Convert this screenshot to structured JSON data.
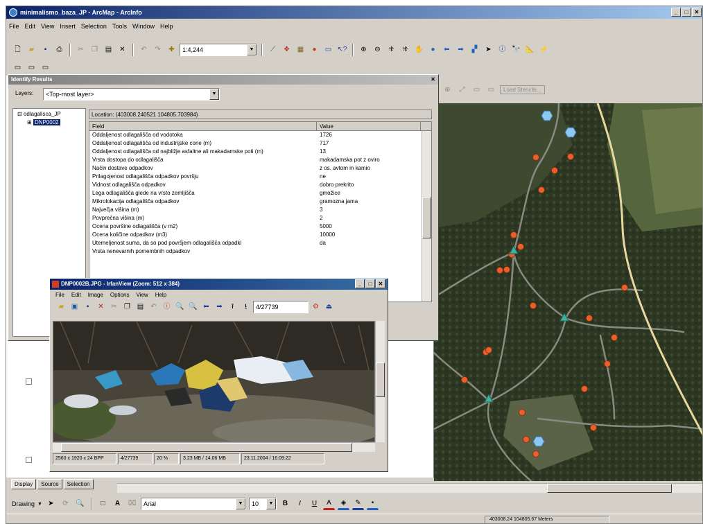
{
  "app": {
    "title": "minimalismo_baza_JP - ArcMap - ArcInfo"
  },
  "menu": [
    "File",
    "Edit",
    "View",
    "Insert",
    "Selection",
    "Tools",
    "Window",
    "Help"
  ],
  "toolbar": {
    "scale": "1:4,244"
  },
  "layer_toolbar": {
    "label": "Load Stencils..."
  },
  "identify": {
    "title": "Identify Results",
    "layers_label": "Layers:",
    "layers_value": "<Top-most layer>",
    "tree_root": "odlagalisca_JP",
    "tree_child": "DNP0002",
    "location": "Location: (403008.240521 104805.703984)",
    "col_field": "Field",
    "col_value": "Value",
    "rows": [
      {
        "f": "Oddaljenost odlagališča od vodotoka",
        "v": "1726"
      },
      {
        "f": "Oddaljenost odlagališča od industrijske cone (m)",
        "v": "717"
      },
      {
        "f": "Oddaljenost odlagališča od najbližje asfaltne ali makadamske poti (m)",
        "v": "13"
      },
      {
        "f": "Vrsta dostopa do odlagališča",
        "v": "makadamska pot z oviro"
      },
      {
        "f": "Način dostave odpadkov",
        "v": "z os. avtom in kamio"
      },
      {
        "f": "Prilagojenost odlagališča odpadkov površju",
        "v": "ne"
      },
      {
        "f": "Vidnost odlagališča odpadkov",
        "v": "dobro prekrito"
      },
      {
        "f": "Lega odlagališča glede na vrsto zemljišča",
        "v": "gmožice"
      },
      {
        "f": "Mikrolokacija odlagališča odpadkov",
        "v": "gramozna jama"
      },
      {
        "f": "Največja višina (m)",
        "v": "3"
      },
      {
        "f": "Povprečna višina (m)",
        "v": "2"
      },
      {
        "f": "Ocena površine odlagališča (v m2)",
        "v": "5000"
      },
      {
        "f": "Ocena količine odpadkov (m3)",
        "v": "10000"
      },
      {
        "f": "Utemeljenost suma, da so pod površjem odlagališča odpadki",
        "v": "da"
      },
      {
        "f": "Vrsta nenevarnih pomembnih odpadkov",
        "v": ""
      }
    ]
  },
  "viewer": {
    "title": "DNP0002B.JPG - IrfanView (Zoom: 512 x 384)",
    "menu": [
      "File",
      "Edit",
      "Image",
      "Options",
      "View",
      "Help"
    ],
    "counter": "4/27739",
    "status": [
      "2560 x 1920 x 24 BPP",
      "4/27739",
      "20 %",
      "3.23 MB / 14.06 MB",
      "23.11.2004 / 16:09:22"
    ]
  },
  "bottom_tabs": [
    "Display",
    "Source",
    "Selection"
  ],
  "drawing": {
    "label": "Drawing",
    "font": "Arial",
    "size": "10"
  },
  "status": {
    "coords": "403008.24  104805.67 Meters"
  }
}
